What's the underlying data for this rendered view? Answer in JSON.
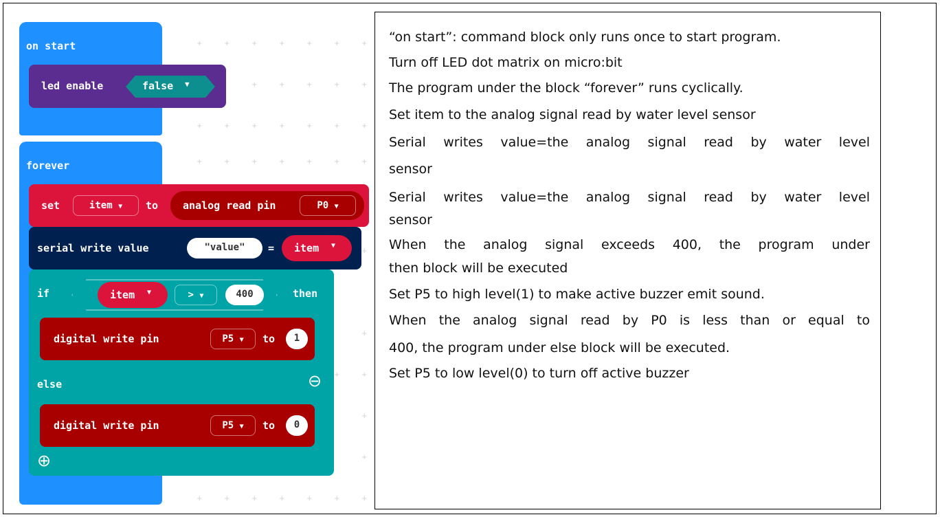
{
  "blocks": {
    "on_start_label": "on start",
    "led_enable_label": "led enable",
    "led_enable_value": "false",
    "dropdown_arrow": "▼",
    "forever_label": "forever",
    "set_label": "set",
    "set_var": "item",
    "to_label": "to",
    "analog_read_label": "analog read pin",
    "analog_pin": "P0",
    "serial_write_label": "serial write value",
    "serial_key": "value",
    "equals_label": "=",
    "serial_var": "item",
    "if_label": "if",
    "compare_var": "item",
    "compare_op": ">",
    "compare_value": "400",
    "then_label": "then",
    "digital_write_label": "digital write pin",
    "dw1_pin": "P5",
    "dw1_to": "to",
    "dw1_value": "1",
    "else_label": "else",
    "minus_icon": "⊖",
    "dw2_pin": "P5",
    "dw2_to": "to",
    "dw2_value": "0",
    "plus_icon": "⊕"
  },
  "colors": {
    "basic_blue": "#1e90ff",
    "led_purple": "#5c2d91",
    "variables_red": "#dc143c",
    "serial_navy": "#002050",
    "logic_teal": "#00a4a6",
    "pins_darkred": "#a80000"
  },
  "notes": [
    "“on start”: command block only runs once to start program.",
    "Turn off LED dot matrix on micro:bit",
    "The program under the block “forever” runs cyclically.",
    "Set item to the analog signal read by water level sensor",
    "Serial writes value=the analog signal read by water level",
    "sensor",
    "Serial writes value=the analog signal read by water level",
    "sensor",
    "When the analog signal exceeds 400, the program under",
    "then block will be executed",
    "Set P5 to high level(1) to make active buzzer emit sound.",
    "When the analog signal read by P0 is less than or equal to",
    "400, the program under else block will be executed.",
    "Set P5 to low level(0) to turn off active buzzer"
  ]
}
